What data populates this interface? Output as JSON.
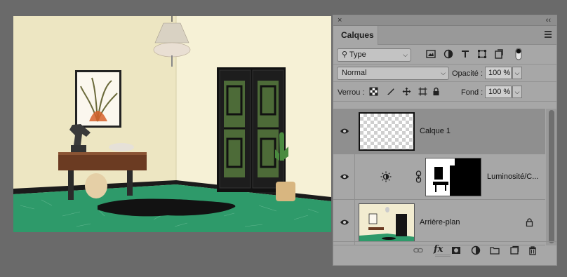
{
  "panel": {
    "tab_label": "Calques",
    "close_glyph": "×",
    "collapse_glyph": "‹‹"
  },
  "filter": {
    "label": "Type",
    "icons": [
      "image-filter-icon",
      "adjustment-filter-icon",
      "text-filter-icon",
      "shape-filter-icon",
      "smart-object-filter-icon",
      "filter-toggle-icon"
    ]
  },
  "blend": {
    "mode": "Normal",
    "opacity_label": "Opacité :",
    "opacity_value": "100 %"
  },
  "lock": {
    "label": "Verrou :",
    "fill_label": "Fond :",
    "fill_value": "100 %"
  },
  "layers": [
    {
      "name": "Calque 1",
      "selected": true
    },
    {
      "name": "Luminosité/C...",
      "selected": false
    },
    {
      "name": "Arrière-plan",
      "selected": false,
      "locked": true
    }
  ],
  "bottom_icons": [
    "link-layers-icon",
    "fx-icon",
    "add-mask-icon",
    "new-adjustment-icon",
    "new-group-icon",
    "new-layer-icon",
    "trash-icon"
  ],
  "fx_label": "fx"
}
